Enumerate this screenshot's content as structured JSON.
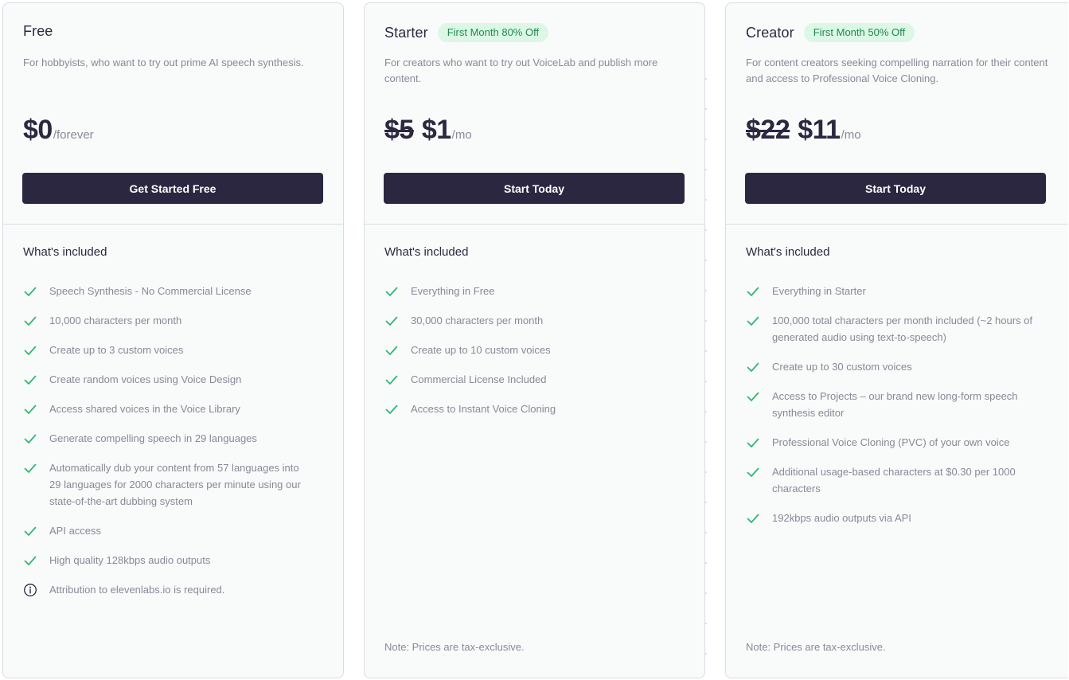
{
  "plans": [
    {
      "name": "Free",
      "badge": "",
      "description": "For hobbyists, who want to try out prime AI speech synthesis.",
      "old_price": "",
      "price": "$0",
      "unit": "/forever",
      "cta": "Get Started Free",
      "included_title": "What's included",
      "features": [
        {
          "icon": "check-icon",
          "text": "Speech Synthesis - No Commercial License"
        },
        {
          "icon": "check-icon",
          "text": "10,000 characters per month"
        },
        {
          "icon": "check-icon",
          "text": "Create up to 3 custom voices"
        },
        {
          "icon": "check-icon",
          "text": "Create random voices using Voice Design"
        },
        {
          "icon": "check-icon",
          "text": "Access shared voices in the Voice Library"
        },
        {
          "icon": "check-icon",
          "text": "Generate compelling speech in 29 languages"
        },
        {
          "icon": "check-icon",
          "text": "Automatically dub your content from 57 languages into 29 languages for 2000 characters per minute using our state-of-the-art dubbing system"
        },
        {
          "icon": "check-icon",
          "text": "API access"
        },
        {
          "icon": "check-icon",
          "text": "High quality 128kbps audio outputs"
        },
        {
          "icon": "info-icon",
          "text": "Attribution to elevenlabs.io is required."
        }
      ],
      "note": ""
    },
    {
      "name": "Starter",
      "badge": "First Month 80% Off",
      "description": "For creators who want to try out VoiceLab and publish more content.",
      "old_price": "$5",
      "price": "$1",
      "unit": "/mo",
      "cta": "Start Today",
      "included_title": "What's included",
      "features": [
        {
          "icon": "check-icon",
          "text": "Everything in Free"
        },
        {
          "icon": "check-icon",
          "text": "30,000 characters per month"
        },
        {
          "icon": "check-icon",
          "text": "Create up to 10 custom voices"
        },
        {
          "icon": "check-icon",
          "text": "Commercial License Included"
        },
        {
          "icon": "check-icon",
          "text": "Access to Instant Voice Cloning"
        }
      ],
      "note": "Note: Prices are tax-exclusive."
    },
    {
      "name": "Creator",
      "badge": "First Month 50% Off",
      "description": "For content creators seeking compelling narration for their content and access to Professional Voice Cloning.",
      "old_price": "$22",
      "price": "$11",
      "unit": "/mo",
      "cta": "Start Today",
      "included_title": "What's included",
      "features": [
        {
          "icon": "check-icon",
          "text": "Everything in Starter"
        },
        {
          "icon": "check-icon",
          "text": "100,000 total characters per month included (~2 hours of generated audio using text-to-speech)"
        },
        {
          "icon": "check-icon",
          "text": "Create up to 30 custom voices"
        },
        {
          "icon": "check-icon",
          "text": "Access to Projects – our brand new long-form speech synthesis editor"
        },
        {
          "icon": "check-icon",
          "text": "Professional Voice Cloning (PVC) of your own voice"
        },
        {
          "icon": "check-icon",
          "text": "Additional usage-based characters at $0.30 per 1000 characters"
        },
        {
          "icon": "check-icon",
          "text": "192kbps audio outputs via API"
        }
      ],
      "note": "Note: Prices are tax-exclusive."
    }
  ],
  "colors": {
    "accent_dark": "#2b2740",
    "check_green": "#2bb673",
    "badge_bg": "#dcf7e6",
    "badge_text": "#1f8a4f"
  }
}
